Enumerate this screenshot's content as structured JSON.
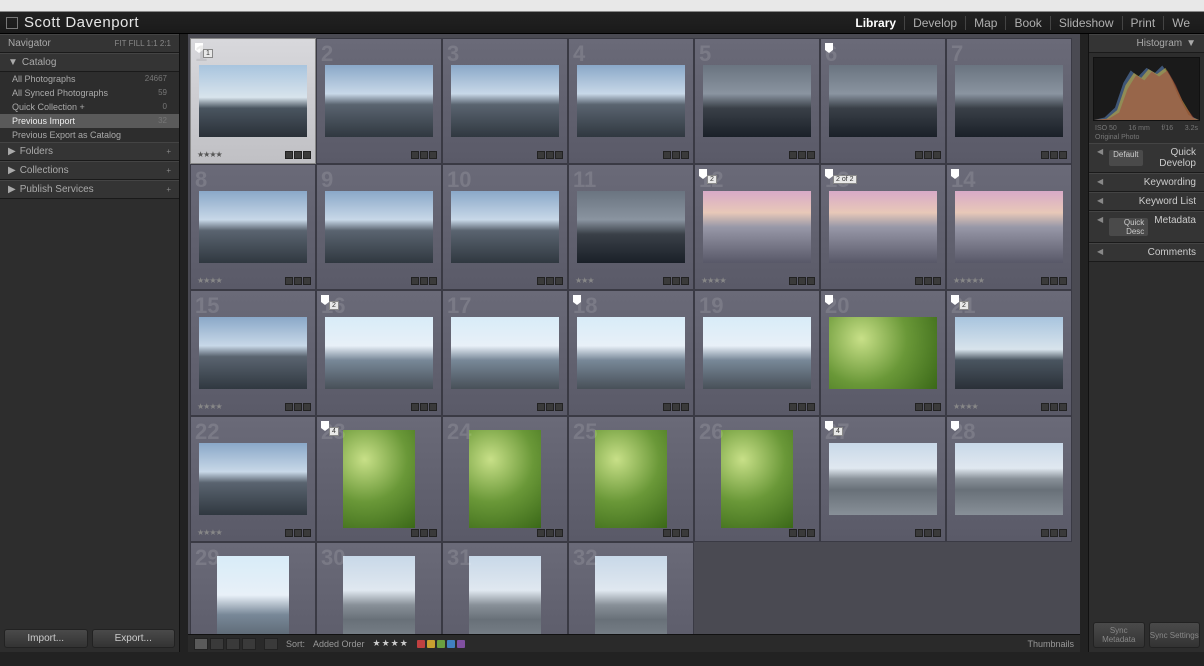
{
  "identity": "Scott Davenport",
  "modules": [
    "Library",
    "Develop",
    "Map",
    "Book",
    "Slideshow",
    "Print",
    "We"
  ],
  "active_module": "Library",
  "left": {
    "navigator": {
      "title": "Navigator",
      "modes": "FIT  FILL  1:1  2:1"
    },
    "catalog": {
      "title": "Catalog",
      "items": [
        {
          "label": "All Photographs",
          "count": "24667"
        },
        {
          "label": "All Synced Photographs",
          "count": "59"
        },
        {
          "label": "Quick Collection +",
          "count": "0"
        },
        {
          "label": "Previous Import",
          "count": "32",
          "sel": true
        },
        {
          "label": "Previous Export as Catalog",
          "count": ""
        }
      ]
    },
    "folders": {
      "title": "Folders"
    },
    "collections": {
      "title": "Collections"
    },
    "publish": {
      "title": "Publish Services"
    },
    "import_btn": "Import...",
    "export_btn": "Export..."
  },
  "right": {
    "histogram": {
      "title": "Histogram",
      "iso": "ISO 50",
      "focal": "16 mm",
      "ap": "f/16",
      "ss": "3.2s",
      "orig": "Original Photo"
    },
    "panels": [
      {
        "title": "Quick Develop",
        "pill": "Default"
      },
      {
        "title": "Keywording"
      },
      {
        "title": "Keyword List"
      },
      {
        "title": "Metadata",
        "pill": "Quick Desc"
      },
      {
        "title": "Comments"
      }
    ],
    "sync_meta": "Sync Metadata",
    "sync_set": "Sync Settings"
  },
  "toolbar": {
    "sort_label": "Sort:",
    "sort_value": "Added Order",
    "stars": "★★★★",
    "colors": [
      "#c04040",
      "#c8a030",
      "#6aa040",
      "#4080c0",
      "#8050a0"
    ],
    "thumbnails": "Thumbnails"
  },
  "grid": [
    {
      "n": 1,
      "t": "t-sky",
      "sel": true,
      "flag": true,
      "rate": 4,
      "stack": "1"
    },
    {
      "n": 2,
      "t": "t-sky2"
    },
    {
      "n": 3,
      "t": "t-sky2"
    },
    {
      "n": 4,
      "t": "t-sky2"
    },
    {
      "n": 5,
      "t": "t-storm"
    },
    {
      "n": 6,
      "t": "t-storm",
      "flag": true
    },
    {
      "n": 7,
      "t": "t-storm"
    },
    {
      "n": 8,
      "t": "t-sky2",
      "rate": 4
    },
    {
      "n": 9,
      "t": "t-sky2"
    },
    {
      "n": 10,
      "t": "t-sky2"
    },
    {
      "n": 11,
      "t": "t-storm",
      "rate": 3,
      "big": true
    },
    {
      "n": 12,
      "t": "t-sunset",
      "rate": 4,
      "flag": true,
      "stack": "2"
    },
    {
      "n": 13,
      "t": "t-sunset",
      "stack": "2 of 2",
      "flag": true
    },
    {
      "n": 14,
      "t": "t-sunset",
      "rate": 5,
      "flag": true
    },
    {
      "n": 15,
      "t": "t-sky2",
      "rate": 4
    },
    {
      "n": 16,
      "t": "t-bright",
      "flag": true,
      "stack": "2"
    },
    {
      "n": 17,
      "t": "t-bright"
    },
    {
      "n": 18,
      "t": "t-bright",
      "flag": true
    },
    {
      "n": 19,
      "t": "t-bright"
    },
    {
      "n": 20,
      "t": "t-green",
      "flag": true
    },
    {
      "n": 21,
      "t": "t-sky",
      "rate": 4,
      "flag": true,
      "stack": "2"
    },
    {
      "n": 22,
      "t": "t-sky2",
      "rate": 4
    },
    {
      "n": 23,
      "t": "t-green",
      "portrait": true,
      "flag": true,
      "stack": "4"
    },
    {
      "n": 24,
      "t": "t-green",
      "portrait": true
    },
    {
      "n": 25,
      "t": "t-green",
      "portrait": true
    },
    {
      "n": 26,
      "t": "t-green",
      "portrait": true
    },
    {
      "n": 27,
      "t": "t-reflect",
      "flag": true,
      "stack": "4"
    },
    {
      "n": 28,
      "t": "t-reflect",
      "flag": true
    },
    {
      "n": 29,
      "t": "t-bright",
      "portrait": true
    },
    {
      "n": 30,
      "t": "t-reflect",
      "portrait": true
    },
    {
      "n": 31,
      "t": "t-reflect",
      "portrait": true
    },
    {
      "n": 32,
      "t": "t-reflect",
      "portrait": true
    }
  ]
}
